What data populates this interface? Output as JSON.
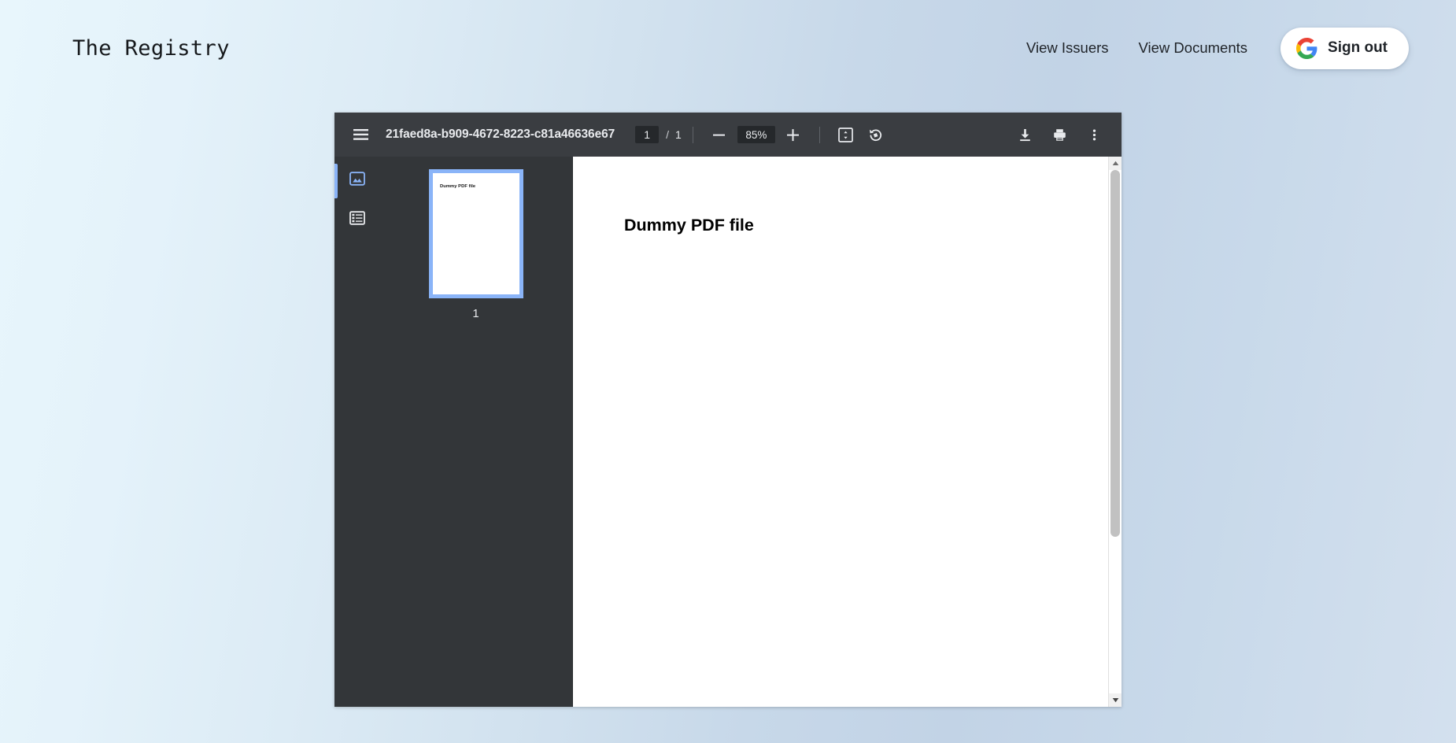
{
  "header": {
    "brand": "The Registry",
    "nav_links": [
      {
        "label": "View Issuers",
        "name": "nav-view-issuers"
      },
      {
        "label": "View Documents",
        "name": "nav-view-documents"
      }
    ],
    "signout": {
      "label": "Sign out",
      "icon": "google-g-icon"
    }
  },
  "pdf_viewer": {
    "toolbar": {
      "menu_icon": "hamburger-menu-icon",
      "filename": "21faed8a-b909-4672-8223-c81a46636e67",
      "page_current": "1",
      "page_separator": "/",
      "page_total": "1",
      "zoom_out_icon": "minus-icon",
      "zoom_level": "85%",
      "zoom_in_icon": "plus-icon",
      "fit_page_icon": "fit-to-page-icon",
      "rotate_icon": "rotate-counterclockwise-icon",
      "download_icon": "download-icon",
      "print_icon": "print-icon",
      "more_icon": "more-vertical-icon"
    },
    "sidebar": {
      "tabs": [
        {
          "label": "Thumbnails",
          "icon": "thumbnail-view-icon",
          "active": true
        },
        {
          "label": "Document outline",
          "icon": "outline-view-icon",
          "active": false
        }
      ],
      "thumbnails": [
        {
          "page_label": "1",
          "preview_text": "Dummy PDF file",
          "selected": true
        }
      ]
    },
    "page": {
      "heading": "Dummy PDF file"
    }
  },
  "colors": {
    "accent_blue": "#8ab4f8",
    "toolbar_bg": "#3a3d41",
    "viewer_bg": "#333639",
    "page_bg": "#ffffff",
    "background_gradient_start": "#e8f6fc",
    "background_gradient_end": "#d3e0ee",
    "google_blue": "#4285F4",
    "google_red": "#EA4335",
    "google_yellow": "#FBBC05",
    "google_green": "#34A853"
  }
}
